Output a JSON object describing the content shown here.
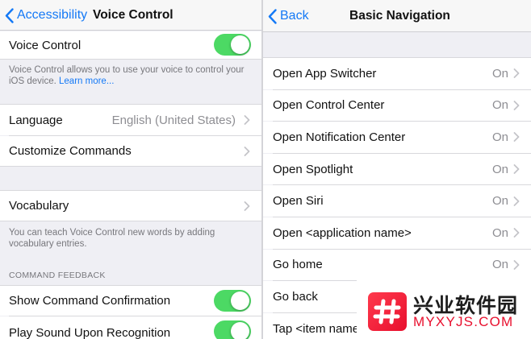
{
  "left": {
    "nav": {
      "back_label": "Accessibility",
      "title": "Voice Control"
    },
    "voice_control": {
      "label": "Voice Control",
      "on": true
    },
    "footer1": {
      "text": "Voice Control allows you to use your voice to control your iOS device.",
      "link": "Learn more..."
    },
    "language": {
      "label": "Language",
      "value": "English (United States)"
    },
    "customize": {
      "label": "Customize Commands"
    },
    "vocabulary": {
      "label": "Vocabulary"
    },
    "footer2": "You can teach Voice Control new words by adding vocabulary entries.",
    "feedback_header": "COMMAND FEEDBACK",
    "show_confirmation": {
      "label": "Show Command Confirmation",
      "on": true
    },
    "play_sound": {
      "label": "Play Sound Upon Recognition",
      "on": true
    }
  },
  "right": {
    "nav": {
      "back_label": "Back",
      "title": "Basic Navigation"
    },
    "items": [
      {
        "label": "Open App Switcher",
        "value": "On"
      },
      {
        "label": "Open Control Center",
        "value": "On"
      },
      {
        "label": "Open Notification Center",
        "value": "On"
      },
      {
        "label": "Open Spotlight",
        "value": "On"
      },
      {
        "label": "Open Siri",
        "value": "On"
      },
      {
        "label": "Open <application name>",
        "value": "On"
      },
      {
        "label": "Go home",
        "value": "On"
      },
      {
        "label": "Go back",
        "value": ""
      },
      {
        "label": "Tap <item name",
        "value": ""
      }
    ]
  },
  "watermark": {
    "title": "兴业软件园",
    "domain": "MYXYJS.COM"
  },
  "colors": {
    "accent": "#1479f6",
    "toggle_on": "#4cd964",
    "watermark_red": "#e8102e"
  },
  "icons": [
    "chevron-left-icon",
    "chevron-right-icon",
    "hash-icon"
  ]
}
